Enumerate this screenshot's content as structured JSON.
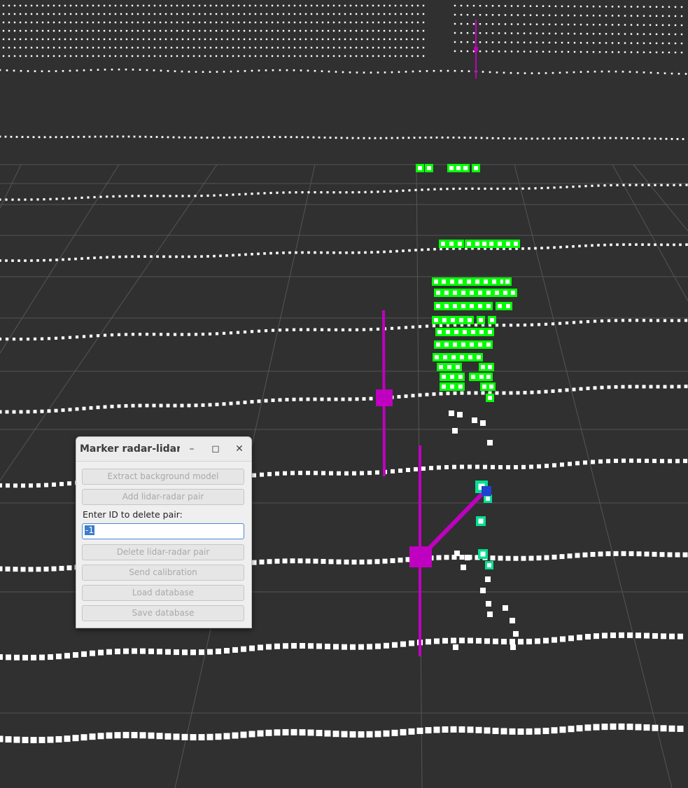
{
  "dialog": {
    "title": "Marker radar-lidar...",
    "buttons": {
      "extract": "Extract background model",
      "add_pair": "Add lidar-radar pair",
      "delete_pair": "Delete lidar-radar pair",
      "send_calibration": "Send calibration",
      "load_database": "Load database",
      "save_database": "Save database"
    },
    "delete_label": "Enter ID to delete pair:",
    "delete_id_value": "-1",
    "window_icons": {
      "minimize": "minimize-icon",
      "maximize": "maximize-icon",
      "close": "close-icon"
    }
  },
  "scene": {
    "background": "#303030",
    "grid_color": "#555555",
    "lidar_color": "#ffffff",
    "cluster_color": "#00ff00",
    "radar_marker_color": "#c000c0",
    "match_color": "#00e090"
  }
}
